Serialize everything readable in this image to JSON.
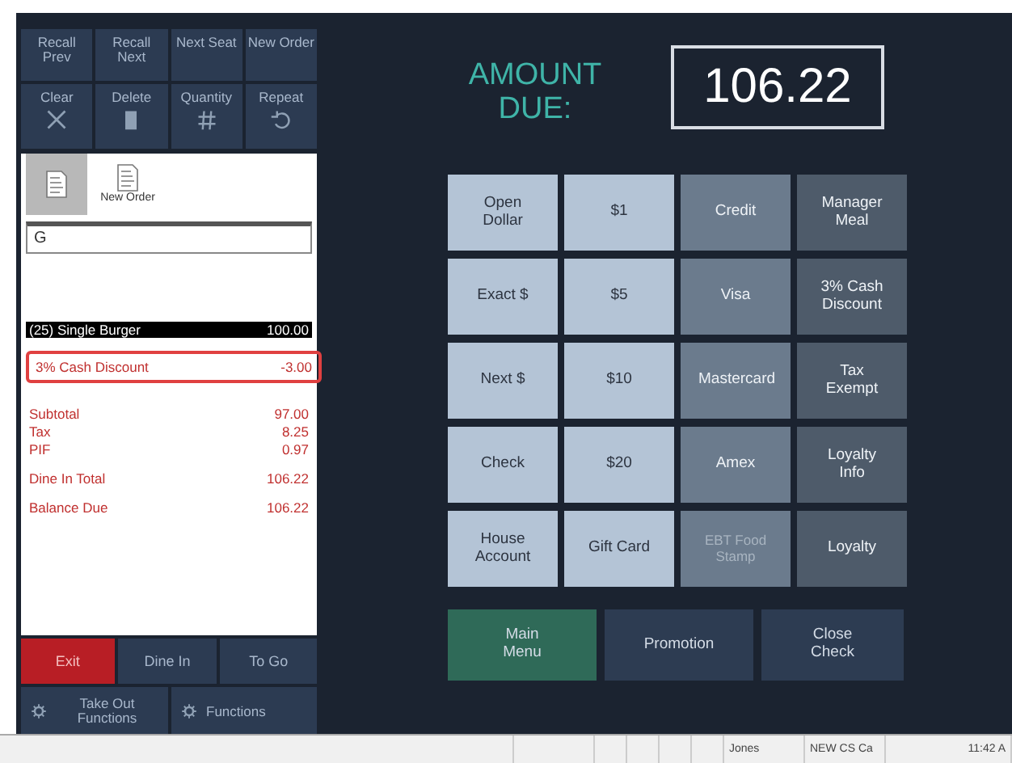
{
  "top_buttons": [
    {
      "label": "Recall Prev"
    },
    {
      "label": "Recall Next"
    },
    {
      "label": "Next Seat"
    },
    {
      "label": "New Order"
    },
    {
      "label": "Clear"
    },
    {
      "label": "Delete"
    },
    {
      "label": "Quantity"
    },
    {
      "label": "Repeat"
    }
  ],
  "order_tabs": [
    {
      "selected": true
    },
    {
      "label": "New Order",
      "selected": false
    }
  ],
  "order_input": {
    "value": "G"
  },
  "order_items": [
    {
      "name": "(25) Single Burger",
      "amount": "100.00",
      "selected": true
    }
  ],
  "discounts": [
    {
      "name": "3% Cash Discount",
      "amount": "-3.00"
    }
  ],
  "total_groups": [
    [
      {
        "name": "Subtotal",
        "amount": "97.00"
      },
      {
        "name": "Tax",
        "amount": "8.25"
      },
      {
        "name": "PIF",
        "amount": "0.97"
      }
    ],
    [
      {
        "name": "Dine In Total",
        "amount": "106.22"
      }
    ],
    [
      {
        "name": "Balance Due",
        "amount": "106.22"
      }
    ]
  ],
  "order_type_buttons": [
    {
      "label": "Exit",
      "kind": "danger"
    },
    {
      "label": "Dine In",
      "kind": "normal"
    },
    {
      "label": "To Go",
      "kind": "normal"
    }
  ],
  "function_buttons": [
    {
      "label": "Take Out Functions"
    },
    {
      "label": "Functions"
    }
  ],
  "amount_due": {
    "label": "AMOUNT DUE:",
    "value": "106.22"
  },
  "payment_buttons": [
    {
      "label": "Open Dollar",
      "kind": "cash"
    },
    {
      "label": "$1",
      "kind": "cash"
    },
    {
      "label": "Credit",
      "kind": "card"
    },
    {
      "label": "Manager Meal",
      "kind": "other"
    },
    {
      "label": "Exact $",
      "kind": "cash"
    },
    {
      "label": "$5",
      "kind": "cash"
    },
    {
      "label": "Visa",
      "kind": "card"
    },
    {
      "label": "3% Cash Discount",
      "kind": "other"
    },
    {
      "label": "Next $",
      "kind": "cash"
    },
    {
      "label": "$10",
      "kind": "cash"
    },
    {
      "label": "Mastercard",
      "kind": "card"
    },
    {
      "label": "Tax Exempt",
      "kind": "other"
    },
    {
      "label": "Check",
      "kind": "cash"
    },
    {
      "label": "$20",
      "kind": "cash"
    },
    {
      "label": "Amex",
      "kind": "card"
    },
    {
      "label": "Loyalty Info",
      "kind": "other"
    },
    {
      "label": "House Account",
      "kind": "cash"
    },
    {
      "label": "Gift Card",
      "kind": "cash"
    },
    {
      "label": "EBT Food Stamp",
      "kind": "card",
      "disabled": true
    },
    {
      "label": "Loyalty",
      "kind": "other"
    }
  ],
  "bottom_buttons": [
    {
      "label": "Main Menu",
      "kind": "primary"
    },
    {
      "label": "Promotion",
      "kind": "normal"
    },
    {
      "label": "Close Check",
      "kind": "normal"
    }
  ],
  "status_bar": [
    "Jones",
    "NEW CS Ca",
    "11:42 A"
  ]
}
